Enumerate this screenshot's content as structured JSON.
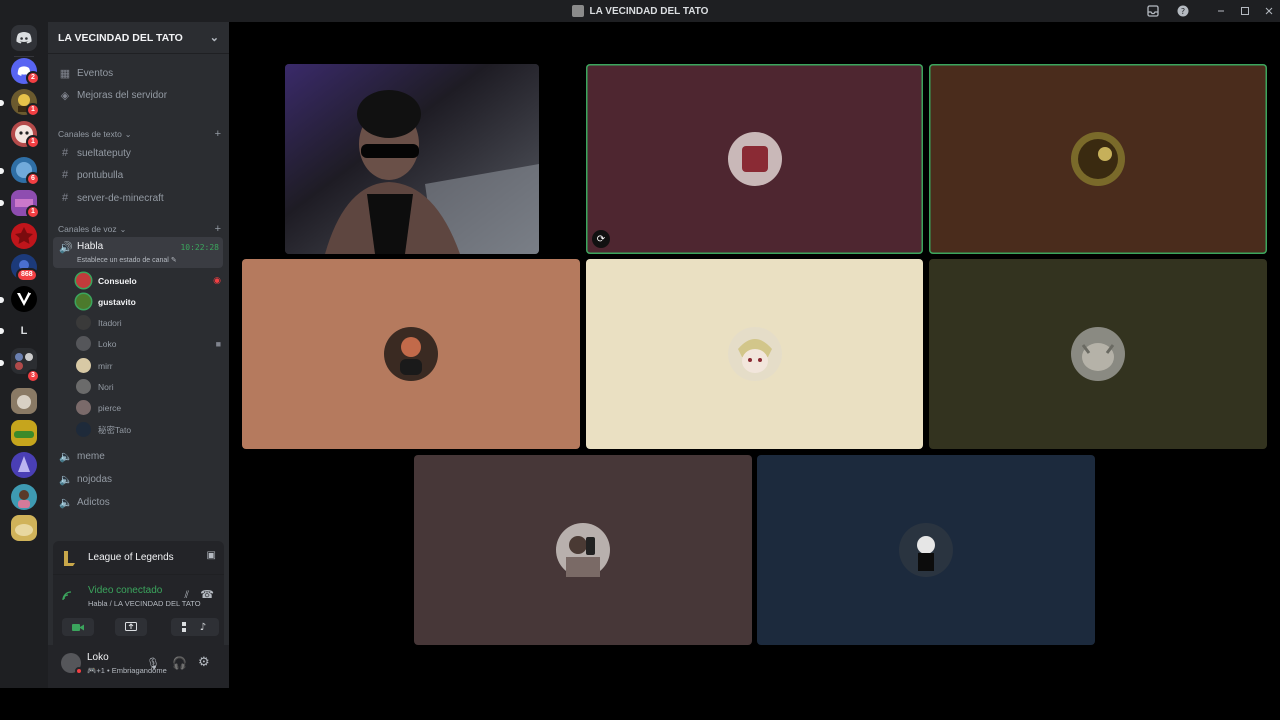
{
  "window": {
    "title": "LA VECINDAD DEL TATO",
    "controls": [
      "inbox-icon",
      "help-icon",
      "minimize-icon",
      "maximize-icon",
      "close-icon"
    ]
  },
  "guilds": {
    "items": [
      {
        "name": "discord-home-icon",
        "color": "#313338",
        "badge": ""
      },
      {
        "name": "guild-1",
        "color": "#5865f2",
        "badge": "2"
      },
      {
        "name": "guild-2",
        "color": "#6b5a2e",
        "badge": "1"
      },
      {
        "name": "guild-3",
        "color": "#b44a4a",
        "badge": "1"
      },
      {
        "name": "guild-4",
        "color": "#2f6fa6",
        "badge": "6"
      },
      {
        "name": "guild-5",
        "color": "#8e4db0",
        "badge": "1"
      },
      {
        "name": "guild-6",
        "color": "#c0151b",
        "badge": ""
      },
      {
        "name": "guild-7",
        "color": "#1c3a7a",
        "badge": "868"
      },
      {
        "name": "guild-8",
        "color": "#000000",
        "badge": ""
      },
      {
        "name": "guild-9",
        "color": "#313338",
        "badge": "",
        "label": "L"
      },
      {
        "name": "guild-10",
        "color": "#3a3d45",
        "badge": "3"
      },
      {
        "name": "guild-11",
        "color": "#8a7a65",
        "badge": ""
      },
      {
        "name": "guild-12",
        "color": "#c6a51d",
        "badge": ""
      },
      {
        "name": "guild-13",
        "color": "#4a3fb5",
        "badge": ""
      },
      {
        "name": "guild-14",
        "color": "#3e9ab2",
        "badge": ""
      },
      {
        "name": "guild-15",
        "color": "#d0b35a",
        "badge": ""
      }
    ]
  },
  "sidebar": {
    "server_name": "LA VECINDAD DEL TATO",
    "top_items": [
      {
        "label": "Eventos",
        "icon": "calendar-icon"
      },
      {
        "label": "Mejoras del servidor",
        "icon": "boost-icon"
      }
    ],
    "text_category": "Canales de texto",
    "text_channels": [
      "sueltateputy",
      "pontubulla",
      "server-de-minecraft"
    ],
    "voice_category": "Canales de voz",
    "active_voice": {
      "name": "Habla",
      "timer": "10:22:28",
      "status_prompt": "Establece un estado de canal"
    },
    "voice_users": [
      {
        "name": "Consuelo",
        "color": "#c23b3b",
        "bold": true,
        "icon": "stream-live-icon"
      },
      {
        "name": "gustavito",
        "color": "#4c7a2c",
        "bold": true,
        "icon": ""
      },
      {
        "name": "Itadori",
        "color": "#3a3a3a",
        "bold": false,
        "icon": ""
      },
      {
        "name": "Loko",
        "color": "#55565a",
        "bold": false,
        "icon": "video-icon"
      },
      {
        "name": "mirr",
        "color": "#d8c9a5",
        "bold": false,
        "icon": ""
      },
      {
        "name": "Nori",
        "color": "#6b6b6b",
        "bold": false,
        "icon": ""
      },
      {
        "name": "pierce",
        "color": "#7a6a6a",
        "bold": false,
        "icon": ""
      },
      {
        "name": "秘密Tato",
        "color": "#1e2a3a",
        "bold": false,
        "icon": ""
      }
    ],
    "other_voice": [
      "meme",
      "nojodas",
      "Adictos"
    ]
  },
  "game_panel": {
    "game": "League of Legends"
  },
  "voice_panel": {
    "status": "Video conectado",
    "location": "Habla / LA VECINDAD DEL TATO",
    "buttons": [
      "camera-icon",
      "screen-share-icon",
      "activities-icon",
      "soundboard-icon"
    ]
  },
  "user_panel": {
    "username": "Loko",
    "status": "• Embriagandome",
    "status_count": "+1"
  },
  "stage": {
    "tiles": [
      {
        "name": "tile-camera",
        "bg": "#2a2830",
        "type": "camera"
      },
      {
        "name": "tile-consuelo",
        "bg": "#4e2630",
        "avatar": "#c9b8b8",
        "speaking": true
      },
      {
        "name": "tile-gustavito",
        "bg": "#4a2c1c",
        "avatar": "#7a6a2a",
        "speaking": true
      },
      {
        "name": "tile-itadori",
        "bg": "#b57a5e",
        "avatar": "#3a2a22"
      },
      {
        "name": "tile-mirr",
        "bg": "#eae0c2",
        "avatar": "#e5ddc8"
      },
      {
        "name": "tile-nori",
        "bg": "#33331f",
        "avatar": "#8a8a82"
      },
      {
        "name": "tile-pierce",
        "bg": "#473738",
        "avatar": "#b8b0ad"
      },
      {
        "name": "tile-tato",
        "bg": "#1c2a3d",
        "avatar": "#2a3440"
      }
    ]
  }
}
